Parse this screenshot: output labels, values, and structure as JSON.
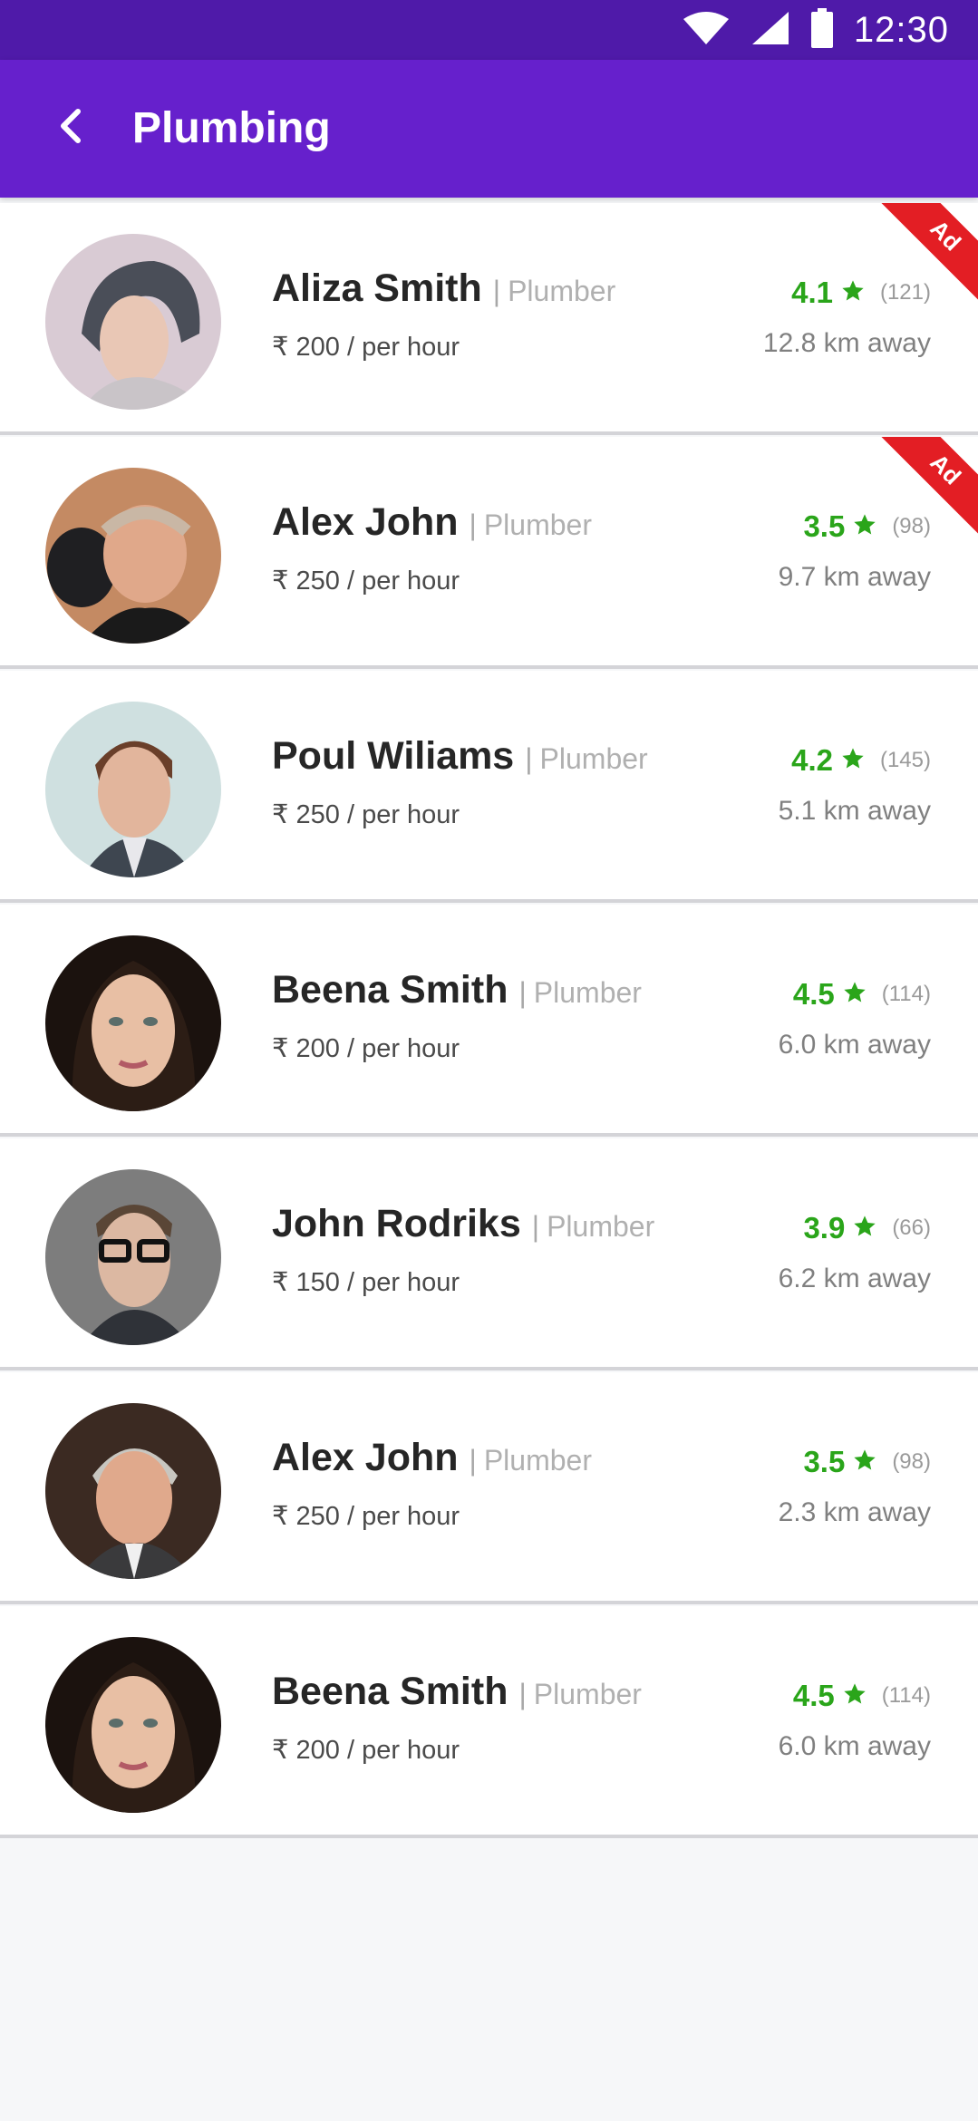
{
  "status_bar": {
    "time": "12:30",
    "icons": [
      "wifi-icon",
      "signal-icon",
      "battery-icon"
    ]
  },
  "app_bar": {
    "title": "Plumbing",
    "back_icon": "back-arrow-icon"
  },
  "colors": {
    "primary": "#6620cc",
    "status_bar": "#4f1aa9",
    "rating_green": "#2aa51a",
    "ad_red": "#e31e24"
  },
  "providers": [
    {
      "name": "Aliza Smith",
      "separator": "|",
      "role": "Plumber",
      "rate": "₹ 200 / per hour",
      "rating": "4.1",
      "reviews": "(121)",
      "distance": "12.8 km away",
      "ad": true,
      "ad_label": "Ad",
      "avatar": "woman-short-hair"
    },
    {
      "name": "Alex John",
      "separator": "|",
      "role": "Plumber",
      "rate": "₹ 250 / per hour",
      "rating": "3.5",
      "reviews": "(98)",
      "distance": "9.7 km away",
      "ad": true,
      "ad_label": "Ad",
      "avatar": "man-bald"
    },
    {
      "name": "Poul Wiliams",
      "separator": "|",
      "role": "Plumber",
      "rate": "₹ 250 / per hour",
      "rating": "4.2",
      "reviews": "(145)",
      "distance": "5.1 km away",
      "ad": false,
      "avatar": "man-young"
    },
    {
      "name": "Beena Smith",
      "separator": "|",
      "role": "Plumber",
      "rate": "₹ 200 / per hour",
      "rating": "4.5",
      "reviews": "(114)",
      "distance": "6.0 km away",
      "ad": false,
      "avatar": "woman-long-hair"
    },
    {
      "name": "John Rodriks",
      "separator": "|",
      "role": "Plumber",
      "rate": "₹ 150 / per hour",
      "rating": "3.9",
      "reviews": "(66)",
      "distance": "6.2 km away",
      "ad": false,
      "avatar": "man-glasses"
    },
    {
      "name": "Alex John",
      "separator": "|",
      "role": "Plumber",
      "rate": "₹ 250 / per hour",
      "rating": "3.5",
      "reviews": "(98)",
      "distance": "2.3 km away",
      "ad": false,
      "avatar": "man-grey-hair"
    },
    {
      "name": "Beena Smith",
      "separator": "|",
      "role": "Plumber",
      "rate": "₹ 200 / per hour",
      "rating": "4.5",
      "reviews": "(114)",
      "distance": "6.0 km away",
      "ad": false,
      "avatar": "woman-long-hair"
    }
  ]
}
